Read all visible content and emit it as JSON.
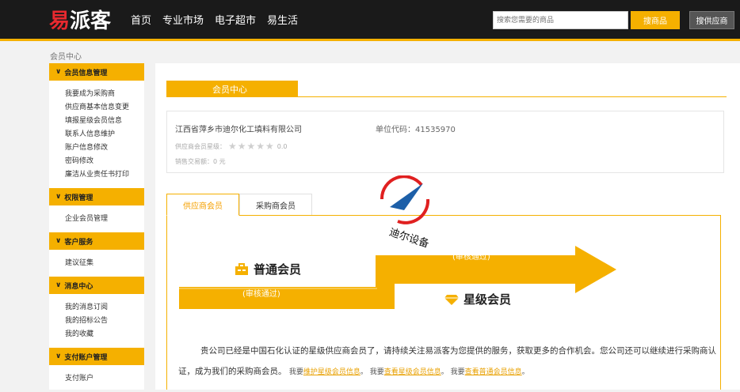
{
  "header": {
    "logo_mark": "易",
    "logo_text": "派客",
    "nav": [
      "首页",
      "专业市场",
      "电子超市",
      "易生活"
    ],
    "search_placeholder": "搜索您需要的商品",
    "search_button": "搜商品",
    "supplier_button": "搜供应商"
  },
  "breadcrumb": "会员中心",
  "sidebar": {
    "groups": [
      {
        "title": "会员信息管理",
        "items": [
          "我要成为采购商",
          "供应商基本信息变更",
          "填报星级会员信息",
          "联系人信息维护",
          "账户信息修改",
          "密码修改",
          "廉洁从业责任书打印"
        ]
      },
      {
        "title": "权限管理",
        "items": [
          "企业会员管理"
        ]
      },
      {
        "title": "客户服务",
        "items": [
          "建议征集"
        ]
      },
      {
        "title": "消息中心",
        "items": [
          "我的消息订阅",
          "我的招标公告",
          "我的收藏"
        ]
      },
      {
        "title": "支付账户管理",
        "items": [
          "支付账户"
        ]
      }
    ]
  },
  "main": {
    "section_title": "会员中心",
    "company_name": "江西省萍乡市迪尔化工填料有限公司",
    "unit_code": "单位代码：41535970",
    "rating_label": "供应商会员星级：",
    "rating_value": "0.0",
    "sales_label": "销售交易额：0 元",
    "tabs": [
      "供应商会员",
      "采购商会员"
    ],
    "normal_member": "普通会员",
    "star_member": "星级会员",
    "audit_lower": "(审核通过)",
    "audit_upper": "(审核通过)",
    "message_main": "贵公司已经是中国石化认证的星级供应商会员了，请持续关注易派客为您提供的服务，获取更多的合作机会。您公司还可以继续进行采购商认证，成为我们的采购商会员。",
    "msg_prefix_1": "我要",
    "link_1": "维护星级会员信息",
    "msg_prefix_2": "我要",
    "link_2": "查看星级会员信息",
    "msg_prefix_3": "我要",
    "link_3": "查看普通会员信息"
  },
  "watermark": {
    "text": "迪尔设备"
  },
  "colors": {
    "accent": "#f5b000",
    "topbar": "#1a1a1a",
    "logo_red": "#e8292f"
  }
}
